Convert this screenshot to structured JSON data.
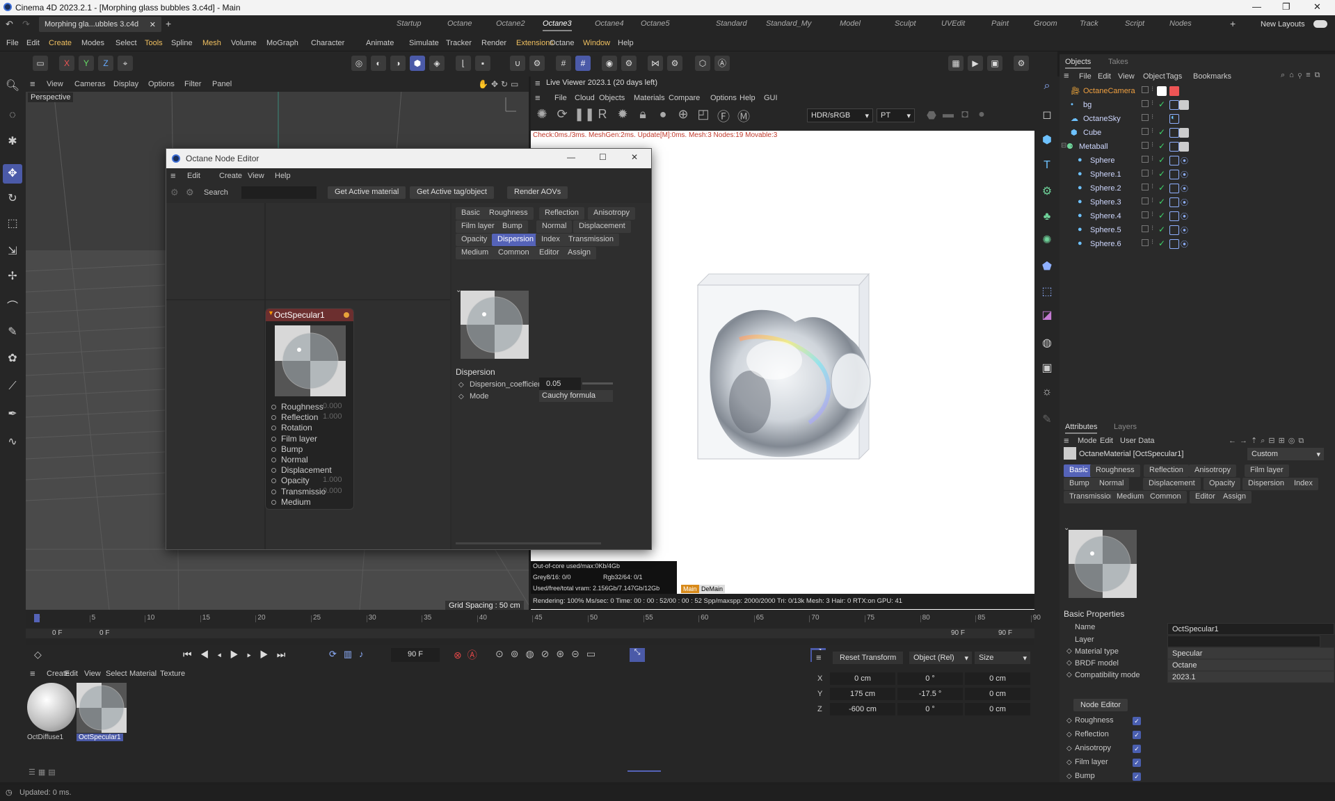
{
  "window": {
    "title": "Cinema 4D 2023.2.1 - [Morphing glass bubbles 3.c4d] - Main"
  },
  "doc_tab": {
    "label": "Morphing gla...ubbles 3.c4d"
  },
  "layout_tabs": [
    "Startup",
    "Octane",
    "Octane2",
    "Octane3",
    "Octane4",
    "Octane5",
    "Standard",
    "Standard_My",
    "Model",
    "Sculpt",
    "UVEdit",
    "Paint",
    "Groom",
    "Track",
    "Script",
    "Nodes"
  ],
  "active_layout": "Octane3",
  "new_layouts": "New Layouts",
  "menu": [
    "File",
    "Edit",
    "Create",
    "Modes",
    "Select",
    "Tools",
    "Spline",
    "Mesh",
    "Volume",
    "MoGraph",
    "Character",
    "Animate",
    "Simulate",
    "Tracker",
    "Render",
    "Extensions",
    "Octane",
    "Window",
    "Help"
  ],
  "axis": {
    "x": "X",
    "y": "Y",
    "z": "Z"
  },
  "viewport": {
    "menu": [
      "View",
      "Cameras",
      "Display",
      "Options",
      "Filter",
      "Panel"
    ],
    "label": "Perspective",
    "grid_spacing": "Grid Spacing : 50 cm"
  },
  "node_editor": {
    "title": "Octane Node Editor",
    "menu": [
      "Edit",
      "Create",
      "View",
      "Help"
    ],
    "search_label": "Search",
    "buttons": [
      "Get Active material",
      "Get Active tag/object",
      "Render AOVs"
    ],
    "node": {
      "title": "OctSpecular1",
      "ports": [
        {
          "label": "Roughness",
          "value": "0.000"
        },
        {
          "label": "Reflection",
          "value": "1.000"
        },
        {
          "label": "Rotation",
          "value": ""
        },
        {
          "label": "Film layer",
          "value": ""
        },
        {
          "label": "Bump",
          "value": ""
        },
        {
          "label": "Normal",
          "value": ""
        },
        {
          "label": "Displacement",
          "value": ""
        },
        {
          "label": "Opacity",
          "value": "1.000"
        },
        {
          "label": "Transmissio",
          "value": "0.000"
        },
        {
          "label": "Medium",
          "value": ""
        }
      ]
    },
    "panel_tabs": [
      "Basic",
      "Roughness",
      "Reflection",
      "Anisotropy",
      "Film layer",
      "Bump",
      "Normal",
      "Displacement",
      "Opacity",
      "Dispersion",
      "Index",
      "Transmission",
      "Medium",
      "Common",
      "Editor",
      "Assign"
    ],
    "active_tab": "Dispersion",
    "section": "Dispersion",
    "param1_label": "Dispersion_coefficient_B",
    "param1_value": "0.05",
    "param2_label": "Mode",
    "param2_value": "Cauchy formula"
  },
  "live_viewer": {
    "title": "Live Viewer 2023.1 (20 days left)",
    "menu": [
      "File",
      "Cloud",
      "Objects",
      "Materials",
      "Compare",
      "Options",
      "Help",
      "GUI"
    ],
    "colorspace": "HDR/sRGB",
    "kernel": "PT",
    "status": "Check:0ms./3ms. MeshGen:2ms. Update[M]:0ms. Mesh:3 Nodes:19 Movable:3",
    "mem1": "Out-of-core used/max:0Kb/4Gb",
    "mem2a": "Grey8/16: 0/0",
    "mem2b": "Rgb32/64: 0/1",
    "mem3": "Used/free/total vram: 2.156Gb/7.147Gb/12Gb",
    "tag1": "Main",
    "tag2": "DeMain",
    "render": "Rendering: 100%  Ms/sec: 0   Time: 00 : 00 : 52/00 : 00 : 52  Spp/maxspp: 2000/2000   Tri: 0/13k   Mesh: 3  Hair: 0   RTX:on   GPU:  41"
  },
  "objects_panel": {
    "tabs": [
      "Objects",
      "Takes"
    ],
    "menu": [
      "File",
      "Edit",
      "View",
      "Object",
      "Tags",
      "Bookmarks"
    ],
    "items": [
      "OctaneCamera",
      "bg",
      "OctaneSky",
      "Cube",
      "Metaball",
      "Sphere",
      "Sphere.1",
      "Sphere.2",
      "Sphere.3",
      "Sphere.4",
      "Sphere.5",
      "Sphere.6"
    ]
  },
  "attributes": {
    "tabs": [
      "Attributes",
      "Layers"
    ],
    "menu": [
      "Mode",
      "Edit",
      "User Data"
    ],
    "object": "OctaneMaterial [OctSpecular1]",
    "preset": "Custom",
    "tabs_row": [
      "Basic",
      "Roughness",
      "Reflection",
      "Anisotropy",
      "Film layer",
      "Bump",
      "Normal",
      "Displacement",
      "Opacity",
      "Dispersion",
      "Index",
      "Transmission",
      "Medium",
      "Common",
      "Editor",
      "Assign"
    ],
    "active_tab": "Basic",
    "section": "Basic Properties",
    "name_label": "Name",
    "name_value": "OctSpecular1",
    "layer_label": "Layer",
    "layer_value": "",
    "material_type_label": "Material type",
    "material_type_value": "Specular",
    "brdf_label": "BRDF model",
    "brdf_value": "Octane",
    "compat_label": "Compatibility mode",
    "compat_value": "2023.1",
    "node_editor_btn": "Node Editor",
    "checks": [
      "Roughness",
      "Reflection",
      "Anisotropy",
      "Film layer",
      "Bump"
    ]
  },
  "timeline": {
    "ticks": [
      "0",
      "5",
      "10",
      "15",
      "20",
      "25",
      "30",
      "35",
      "40",
      "45",
      "50",
      "55",
      "60",
      "65",
      "70",
      "75",
      "80",
      "85",
      "90"
    ],
    "start": "0 F",
    "start2": "0 F",
    "end": "90 F",
    "end2": "90 F",
    "current": "90 F"
  },
  "materials": {
    "menu": [
      "Create",
      "Edit",
      "View",
      "Select",
      "Material",
      "Texture"
    ],
    "items": [
      "OctDiffuse1",
      "OctSpecular1"
    ]
  },
  "coords": {
    "reset": "Reset Transform",
    "mode": "Object (Rel)",
    "size": "Size",
    "rows": [
      {
        "axis": "X",
        "pos": "0 cm",
        "rot": "0 °",
        "size": "0 cm"
      },
      {
        "axis": "Y",
        "pos": "175 cm",
        "rot": "-17.5 °",
        "size": "0 cm"
      },
      {
        "axis": "Z",
        "pos": "-600 cm",
        "rot": "0 °",
        "size": "0 cm"
      }
    ]
  },
  "status": "Updated: 0 ms."
}
